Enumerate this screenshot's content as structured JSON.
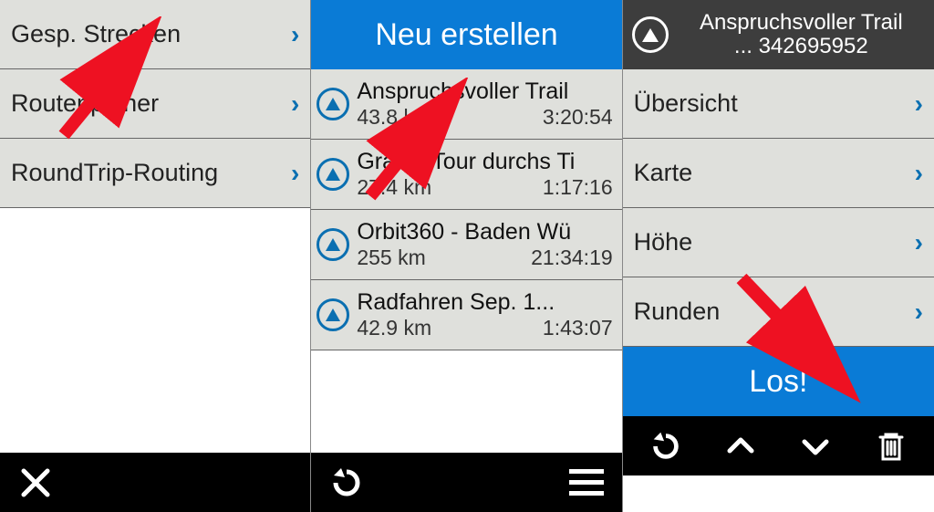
{
  "screen1": {
    "menu": [
      {
        "label": "Gesp. Strecken"
      },
      {
        "label": "Routenplaner"
      },
      {
        "label": "RoundTrip-Routing"
      }
    ]
  },
  "screen2": {
    "header": "Neu erstellen",
    "tracks": [
      {
        "title": "Anspruchsvoller Trail",
        "dist": "43.8 km",
        "time": "3:20:54"
      },
      {
        "title": "Gravel-Tour durchs Ti",
        "dist": "27.4 km",
        "time": "1:17:16"
      },
      {
        "title": "Orbit360 - Baden Wü",
        "dist": "255 km",
        "time": "21:34:19"
      },
      {
        "title": "Radfahren Sep. 1...",
        "dist": "42.9 km",
        "time": "1:43:07"
      }
    ]
  },
  "screen3": {
    "header": {
      "title": "Anspruchsvoller Trail",
      "sub": "... 342695952"
    },
    "menu": [
      {
        "label": "Übersicht"
      },
      {
        "label": "Karte"
      },
      {
        "label": "Höhe"
      },
      {
        "label": "Runden"
      }
    ],
    "go": "Los!"
  }
}
